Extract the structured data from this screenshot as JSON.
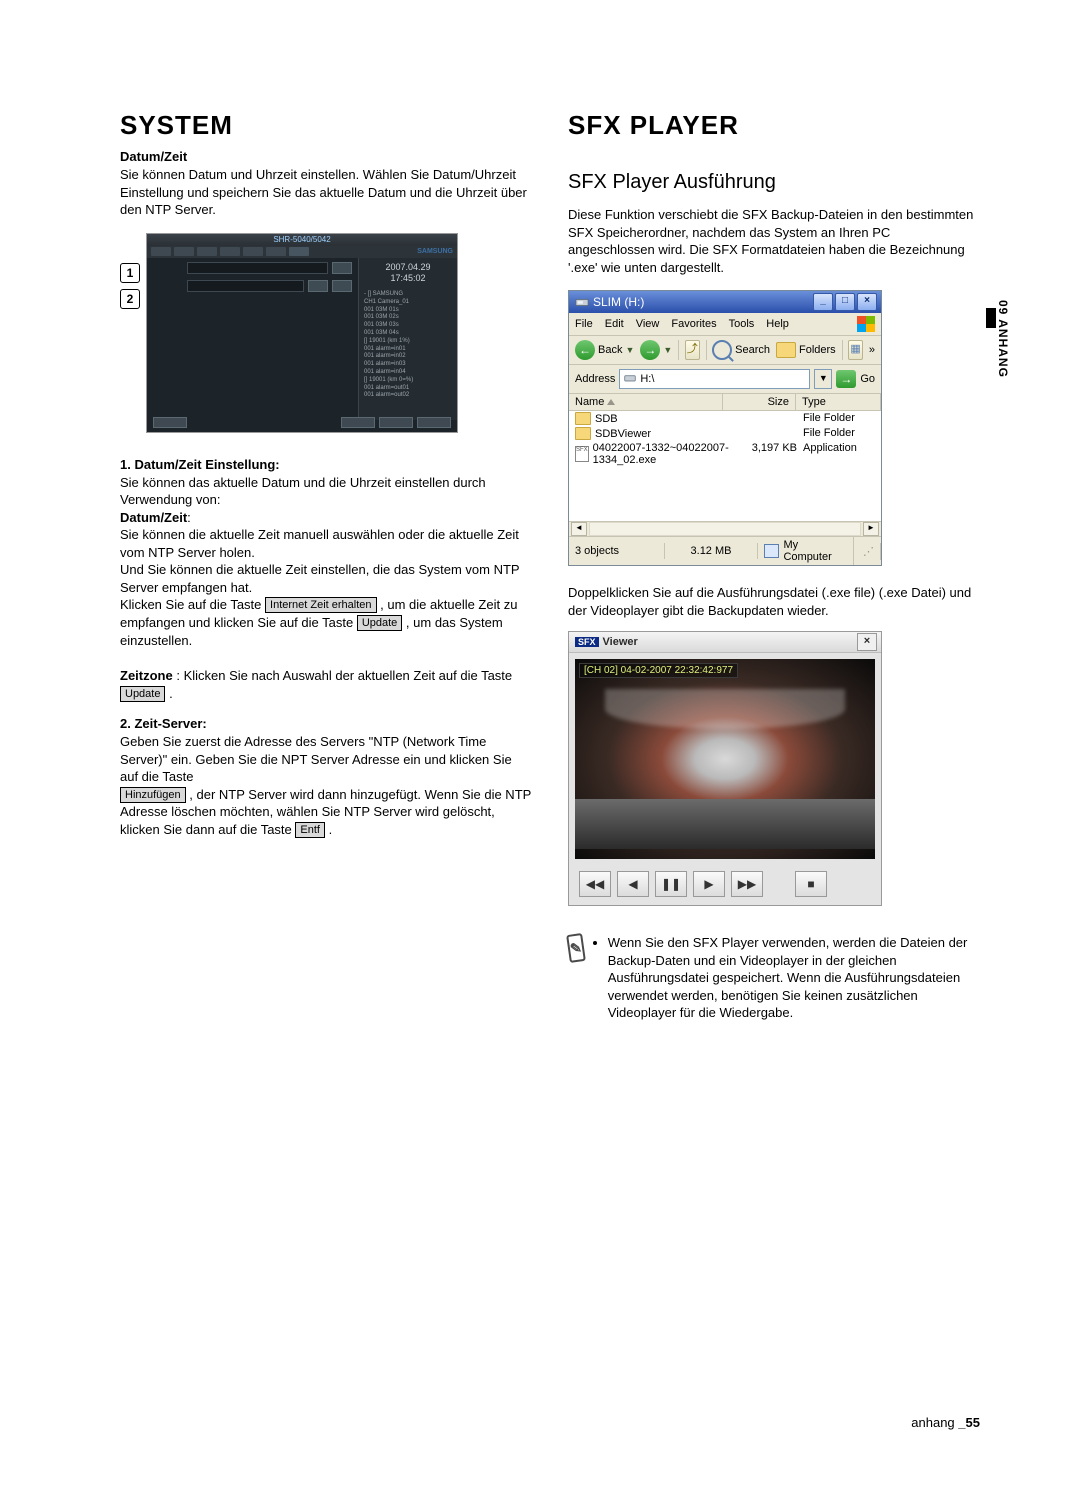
{
  "left": {
    "h1": "SYSTEM",
    "sub1": "Datum/Zeit",
    "intro": "Sie können Datum und Uhrzeit einstellen. Wählen Sie Datum/Uhrzeit Einstellung und speichern Sie das aktuelle Datum und die Uhrzeit über den NTP Server.",
    "callout1": "1",
    "callout2": "2",
    "dvr": {
      "title": "SHR-5040/5042",
      "right_date": "2007.04.29",
      "right_time": "17:45:02",
      "tree": [
        "- [] SAMSUNG",
        "   CH1 Camera_01",
        "       001 03M 01s",
        "       001 03M 02s",
        "       001 03M 03s",
        "       001 03M 04s",
        "   [] 19001 (km 1%)",
        "       001 alarm=in01",
        "       001 alarm=in02",
        "       001 alarm=in03",
        "       001 alarm=in04",
        "   [] 19001 (km 0=%)",
        "       001 alarm=out01",
        "       001 alarm=out02"
      ]
    },
    "s1_title": "1. Datum/Zeit Einstellung:",
    "s1_body": "Sie können das aktuelle Datum und die Uhrzeit einstellen durch Verwendung von:",
    "s1_boldlabel": "Datum/Zeit",
    "s1_body2a": "Sie können die aktuelle Zeit manuell auswählen oder die aktuelle Zeit vom NTP Server holen.",
    "s1_body2b": "Und Sie können die aktuelle Zeit einstellen, die das System vom NTP Server empfangen hat.",
    "s1_body3_pre": "Klicken Sie auf die Taste ",
    "btn_internet": "Internet Zeit erhalten",
    "s1_body3_mid": ", um die aktuelle Zeit zu empfangen und klicken Sie auf die Taste ",
    "btn_update": "Update",
    "s1_body3_post": ", um das System einzustellen.",
    "s1_zeitzone_label": "Zeitzone",
    "s1_zeitzone_text": ": Klicken Sie nach Auswahl der aktuellen Zeit auf die Taste ",
    "s1_zeitzone_post": ".",
    "s2_title": "2. Zeit-Server:",
    "s2_body_a": "Geben Sie zuerst die Adresse des Servers \"NTP (Network Time Server)\" ein. Geben Sie die NPT Server Adresse ein und klicken Sie auf die Taste",
    "btn_add": "Hinzufügen",
    "s2_body_b": ", der NTP Server wird dann hinzugefügt. Wenn Sie die NTP Adresse löschen möchten, wählen Sie NTP Server wird gelöscht, klicken Sie dann auf die Taste ",
    "btn_del": "Entf",
    "s2_body_c": "."
  },
  "right": {
    "h1": "SFX PLAYER",
    "big_sub": "SFX Player Ausführung",
    "intro": "Diese Funktion verschiebt die SFX Backup-Dateien in den bestimmten SFX Speicherordner, nachdem das System an Ihren PC angeschlossen wird. Die SFX Formatdateien haben die Bezeichnung '.exe' wie unten dargestellt.",
    "explorer": {
      "title": "SLIM (H:)",
      "menus": [
        "File",
        "Edit",
        "View",
        "Favorites",
        "Tools",
        "Help"
      ],
      "back": "Back",
      "search": "Search",
      "folders": "Folders",
      "address_label": "Address",
      "address_value": "H:\\",
      "go": "Go",
      "cols": {
        "name": "Name",
        "size": "Size",
        "type": "Type"
      },
      "rows": [
        {
          "name": "SDB",
          "size": "",
          "type": "File Folder"
        },
        {
          "name": "SDBViewer",
          "size": "",
          "type": "File Folder"
        },
        {
          "name": "04022007-1332~04022007-1334_02.exe",
          "size": "3,197 KB",
          "type": "Application",
          "exe": true
        }
      ],
      "status": {
        "objects": "3 objects",
        "size": "3.12 MB",
        "location": "My Computer"
      }
    },
    "mid_para": "Doppelklicken Sie auf die Ausführungsdatei (.exe file) (.exe Datei) und der Videoplayer gibt die Backupdaten wieder.",
    "viewer": {
      "title_logo": "SFX",
      "title": "Viewer",
      "overlay": "[CH 02]  04-02-2007 22:32:42:977"
    },
    "note": "Wenn Sie den SFX Player verwenden, werden die Dateien der Backup-Daten und ein Videoplayer in der gleichen Ausführungsdatei gespeichert. Wenn die Ausführungsdateien verwendet werden, benötigen Sie keinen zusätzlichen Videoplayer für die Wiedergabe."
  },
  "side_tab": "09 ANHANG",
  "footer_left": "anhang",
  "footer_right": "_55"
}
